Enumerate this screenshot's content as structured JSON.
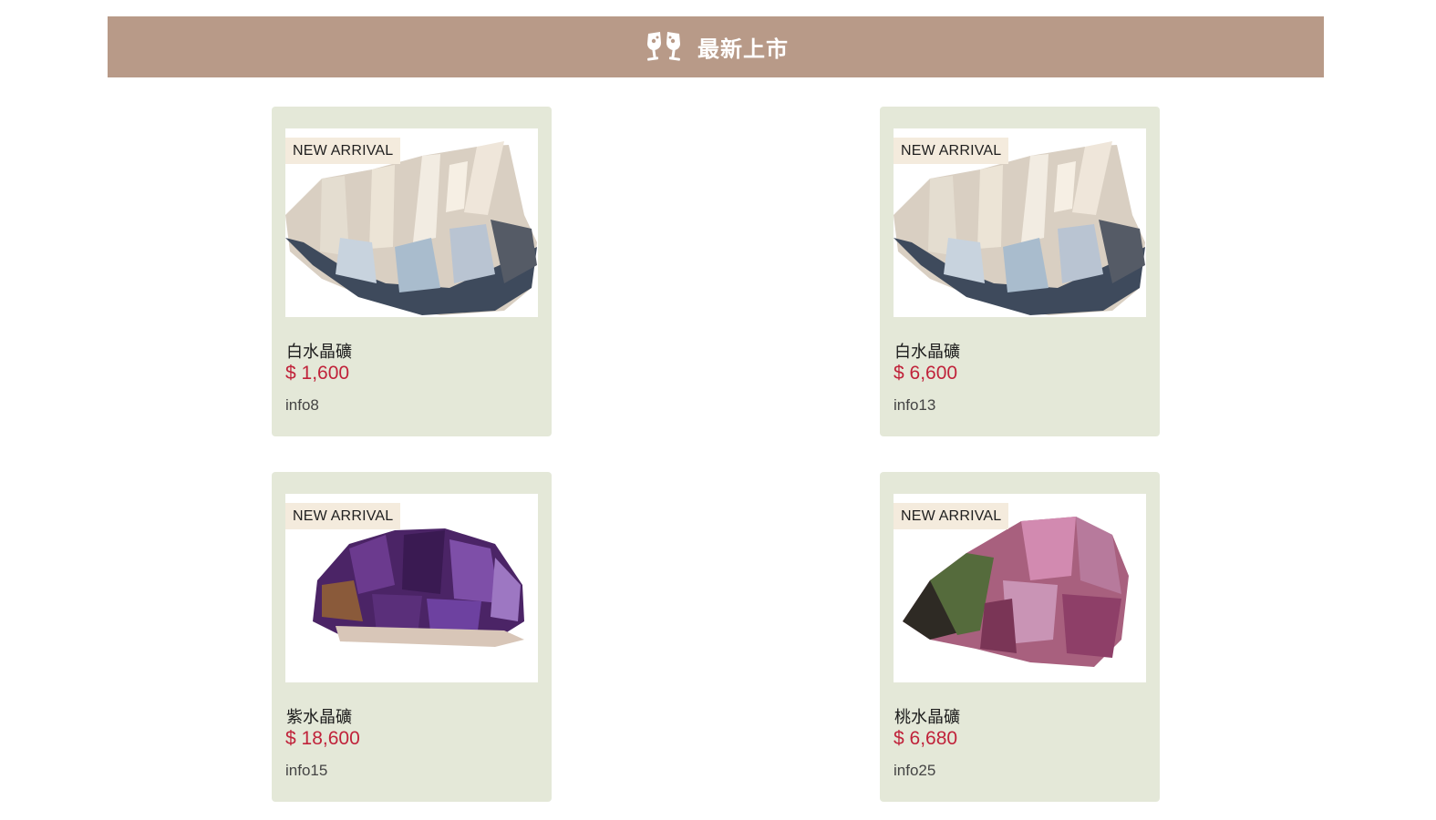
{
  "header": {
    "title": "最新上市",
    "icon": "wine-glasses-toast-icon",
    "background": "#b89a88"
  },
  "colors": {
    "card_background": "#e4e8d8",
    "price": "#c0223a",
    "badge_background": "#f4ebdd"
  },
  "products": [
    {
      "badge": "NEW ARRIVAL",
      "name": "白水晶礦",
      "price": "$ 1,600",
      "info": "info8",
      "image": "clear-quartz-cluster-image"
    },
    {
      "badge": "NEW ARRIVAL",
      "name": "白水晶礦",
      "price": "$ 6,600",
      "info": "info13",
      "image": "clear-quartz-cluster-image"
    },
    {
      "badge": "NEW ARRIVAL",
      "name": "紫水晶礦",
      "price": "$ 18,600",
      "info": "info15",
      "image": "amethyst-cluster-image"
    },
    {
      "badge": "NEW ARRIVAL",
      "name": "桃水晶礦",
      "price": "$ 6,680",
      "info": "info25",
      "image": "pink-crystal-rough-image"
    }
  ]
}
